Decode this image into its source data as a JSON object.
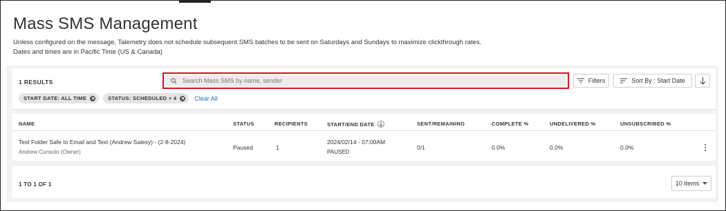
{
  "page": {
    "title": "Mass SMS Management",
    "subtitle_line1": "Unless configured on the message, Talemetry does not schedule subsequent SMS batches to be sent on Saturdays and Sundays to maximize clickthrough rates.",
    "subtitle_line2": "Dates and times are in Pacific Time (US & Canada)"
  },
  "toolbar": {
    "results_count": "1 RESULTS",
    "search_placeholder": "Search Mass SMS by name, sender",
    "search_value": "",
    "filters_label": "Filters",
    "sort_label": "Sort By : Start Date"
  },
  "chips": [
    {
      "label": "START DATE: ALL TIME"
    },
    {
      "label": "STATUS: SCHEDULED + 4"
    }
  ],
  "clear_all_label": "Clear All",
  "table": {
    "columns": [
      "NAME",
      "STATUS",
      "RECIPIENTS",
      "START/END DATE",
      "SENT/REMAINING",
      "COMPLETE %",
      "UNDELIVERED %",
      "UNSUBSCRIBED %"
    ],
    "rows": [
      {
        "name": "Test Folder Safe to Email and Text (Andrew Salesy) - (2-8-2024)",
        "owner": "Andrew Cunsolo (Owner)",
        "status": "Paused",
        "recipients": "1",
        "start_date": "2024/02/14 - 07:00AM",
        "end_state": "PAUSED",
        "sent_remaining": "0/1",
        "complete": "0.0%",
        "undelivered": "0.0%",
        "unsubscribed": "0.0%"
      }
    ]
  },
  "pagination": {
    "range_text": "1 TO 1 OF 1",
    "items_per_page": "10 Items"
  },
  "colors": {
    "highlight_border": "#d0161c",
    "link": "#1f6fc4"
  }
}
